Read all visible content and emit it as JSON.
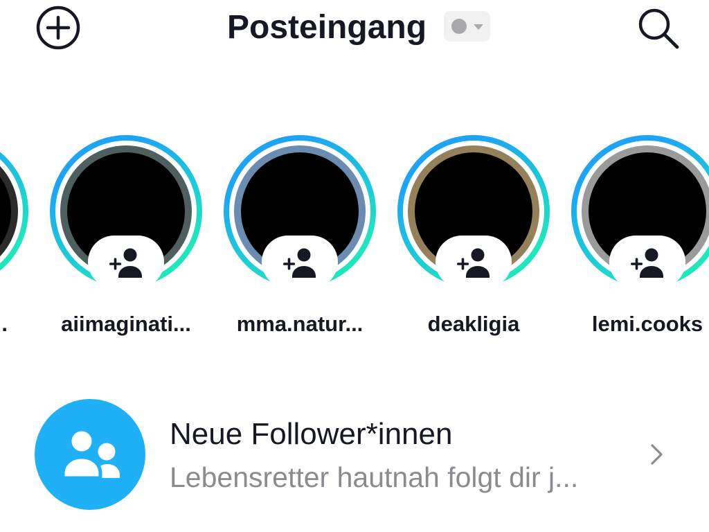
{
  "header": {
    "title": "Posteingang",
    "add_icon": "plus-circle-icon",
    "status_icon": "status-dot-icon",
    "status_dropdown_icon": "caret-down-icon",
    "search_icon": "search-icon"
  },
  "stories": {
    "ring_gradient": [
      "#1ea3f5",
      "#20e6bd"
    ],
    "add_friend_icon": "person-add-icon",
    "items": [
      {
        "username": ".",
        "photo_color": "#2b2b2b"
      },
      {
        "username": "aiimaginati...",
        "photo_color": "#4f5f5f"
      },
      {
        "username": "mma.natur...",
        "photo_color": "#6b8cb0"
      },
      {
        "username": "deakligia",
        "photo_color": "#94805a"
      },
      {
        "username": "lemi.cooks",
        "photo_color": "#9a9a9a"
      }
    ]
  },
  "new_followers": {
    "title": "Neue Follower*innen",
    "subtitle": "Lebensretter hautnah folgt dir j...",
    "icon": "two-people-icon",
    "icon_bg": "#1fb0f5",
    "chevron_icon": "chevron-right-icon"
  },
  "colors": {
    "text": "#161823",
    "secondary_text": "#8a8b91",
    "status": "#a9a9ad",
    "pill_bg": "#f1f1f2",
    "background": "#ffffff"
  }
}
